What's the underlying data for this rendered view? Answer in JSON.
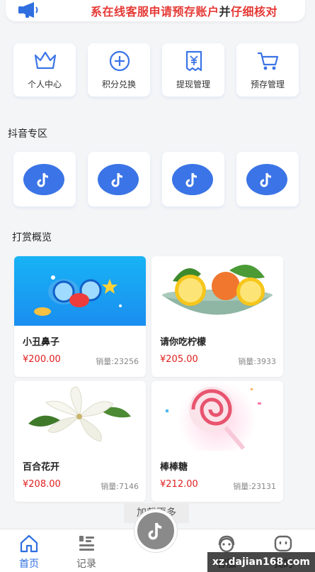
{
  "notice": {
    "icon": "megaphone-icon",
    "text_red": "系在线客服申请预存账户",
    "text_dark": "并",
    "text_red2": "仔细核对"
  },
  "menu": [
    {
      "label": "个人中心",
      "icon": "crown-icon"
    },
    {
      "label": "积分兑换",
      "icon": "plus-circle-icon"
    },
    {
      "label": "提现管理",
      "icon": "yuan-receipt-icon"
    },
    {
      "label": "预存管理",
      "icon": "cart-icon"
    }
  ],
  "douyin": {
    "title": "抖音专区",
    "items": [
      {
        "icon": "tiktok-icon"
      },
      {
        "icon": "tiktok-icon"
      },
      {
        "icon": "tiktok-icon"
      },
      {
        "icon": "tiktok-icon"
      }
    ]
  },
  "reward": {
    "title": "打赏概览",
    "products": [
      {
        "name": "小丑鼻子",
        "price": "¥200.00",
        "sales": "销量:23256",
        "image": "clown-nose-image"
      },
      {
        "name": "请你吃柠檬",
        "price": "¥205.00",
        "sales": "销量:3933",
        "image": "lemon-bowl-image"
      },
      {
        "name": "百合花开",
        "price": "¥208.00",
        "sales": "销量:7146",
        "image": "lily-flower-image"
      },
      {
        "name": "棒棒糖",
        "price": "¥212.00",
        "sales": "销量:23131",
        "image": "lollipop-image"
      }
    ],
    "load_more": "加载更多"
  },
  "tabbar": {
    "tabs": [
      {
        "label": "首页",
        "icon": "home-icon",
        "active": true
      },
      {
        "label": "记录",
        "icon": "list-icon",
        "active": false
      },
      {
        "label": "",
        "icon": "tiktok-icon",
        "active": false
      },
      {
        "label": "客服",
        "icon": "support-icon",
        "active": false
      },
      {
        "label": "我的",
        "icon": "profile-icon",
        "active": false
      }
    ]
  },
  "watermark": "xz.dajian168.com",
  "colors": {
    "accent": "#2f6fe0",
    "price": "#e02020",
    "douyin": "#3b74e6",
    "background": "#f4f5f7"
  }
}
